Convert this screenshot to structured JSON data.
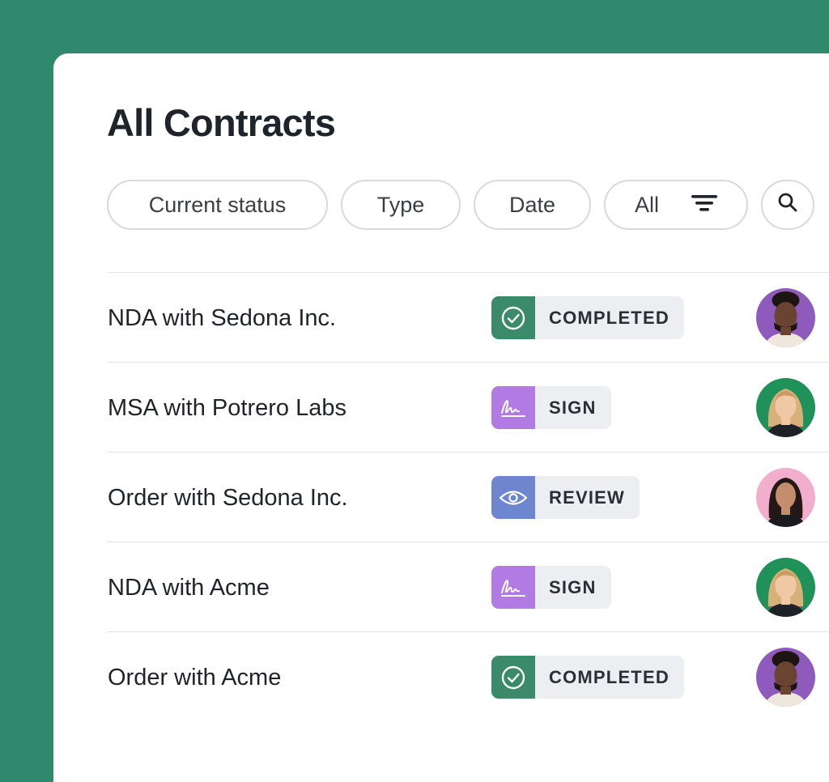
{
  "page": {
    "title": "All Contracts"
  },
  "filters": {
    "current_status": "Current status",
    "type": "Type",
    "date": "Date",
    "all": "All",
    "filter_icon": "filter-lines-icon",
    "search_icon": "search-icon"
  },
  "colors": {
    "background": "#31896d",
    "completed": "#3b8a6a",
    "sign": "#b27be3",
    "review": "#6e86cf"
  },
  "contracts": [
    {
      "name": "NDA with Sedona Inc.",
      "status": "COMPLETED",
      "status_icon": "check-circle-icon",
      "avatar": "person-avatar-purple"
    },
    {
      "name": "MSA with Potrero Labs",
      "status": "SIGN",
      "status_icon": "signature-icon",
      "avatar": "person-avatar-green"
    },
    {
      "name": "Order with Sedona Inc.",
      "status": "REVIEW",
      "status_icon": "eye-icon",
      "avatar": "person-avatar-pink"
    },
    {
      "name": "NDA with Acme",
      "status": "SIGN",
      "status_icon": "signature-icon",
      "avatar": "person-avatar-green"
    },
    {
      "name": "Order with Acme",
      "status": "COMPLETED",
      "status_icon": "check-circle-icon",
      "avatar": "person-avatar-purple"
    }
  ]
}
